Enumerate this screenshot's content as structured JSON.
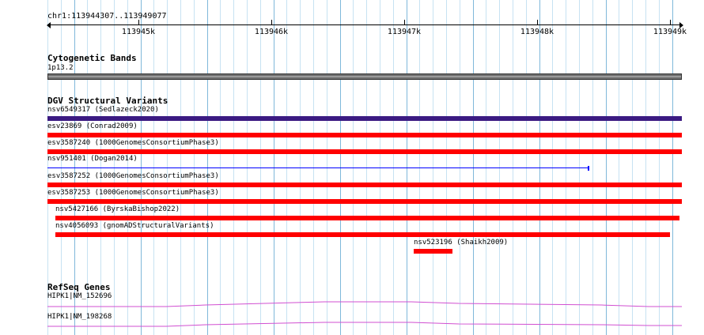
{
  "ruler": {
    "location": "chr1:113944307..113949077",
    "ticks": [
      "113945k",
      "113946k",
      "113947k",
      "113948k",
      "113949k"
    ]
  },
  "cytobands": {
    "title": "Cytogenetic Bands",
    "band_label": "1p13.2"
  },
  "dgv": {
    "title": "DGV Structural Variants",
    "features": [
      {
        "label": "nsv6549317 (Sedlazeck2020)",
        "color": "#3b1a82"
      },
      {
        "label": "esv23869 (Conrad2009)",
        "color": "#ff0000"
      },
      {
        "label": "esv3587240 (1000GenomesConsortiumPhase3)",
        "color": "#ff0000"
      },
      {
        "label": "nsv951401 (Dogan2014)",
        "color": "#0000ff"
      },
      {
        "label": "esv3587252 (1000GenomesConsortiumPhase3)",
        "color": "#ff0000"
      },
      {
        "label": "esv3587253 (1000GenomesConsortiumPhase3)",
        "color": "#ff0000"
      },
      {
        "label": "nsv5427166 (ByrskaBishop2022)",
        "color": "#ff0000"
      },
      {
        "label": "nsv4056093 (gnomADStructuralVariants)",
        "color": "#ff0000"
      },
      {
        "label": "nsv523196 (Shaikh2009)",
        "color": "#ff0000"
      }
    ]
  },
  "refseq": {
    "title": "RefSeq Genes",
    "color": "#d14fd1",
    "genes": [
      {
        "label": "HIPK1|NM_152696"
      },
      {
        "label": "HIPK1|NM_198268"
      }
    ]
  }
}
